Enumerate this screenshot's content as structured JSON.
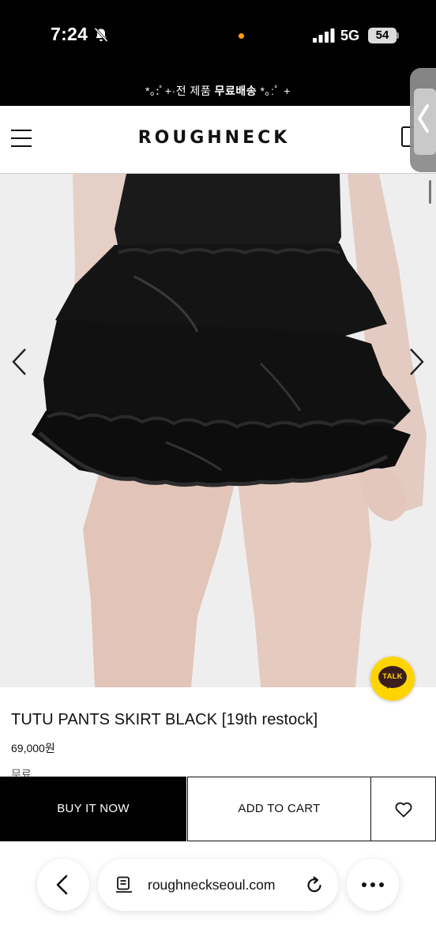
{
  "status_bar": {
    "time": "7:24",
    "network": "5G",
    "battery": "54",
    "icons": [
      "bell-slash-icon",
      "signal-icon",
      "battery-icon"
    ],
    "orange_dot_color": "#ff9f0a"
  },
  "promo": {
    "prefix": "*｡:ﾟ+·전 제품 ",
    "bold": "무료배송",
    "suffix": " *｡:ﾟ +"
  },
  "header": {
    "brand": "ROUGHNECK",
    "menu_icon": "hamburger-menu-icon",
    "cart_icon": "shopping-bag-icon"
  },
  "product": {
    "image_alt": "model wearing black tiered ruffle tutu skirt",
    "title": "TUTU PANTS SKIRT BLACK [19th restock]",
    "price": "69,000원",
    "shipping": "무료"
  },
  "gallery": {
    "prev_icon": "chevron-left-icon",
    "next_icon": "chevron-right-icon"
  },
  "kakao": {
    "label": "TALK",
    "color": "#ffd400"
  },
  "actions": {
    "buy_label": "BUY IT NOW",
    "cart_label": "ADD TO CART",
    "wishlist_icon": "heart-icon"
  },
  "browser": {
    "url": "roughneckseoul.com",
    "back_icon": "chevron-left-icon",
    "page_icon": "page-settings-icon",
    "reload_icon": "reload-icon",
    "more_icon": "more-dots-icon"
  }
}
